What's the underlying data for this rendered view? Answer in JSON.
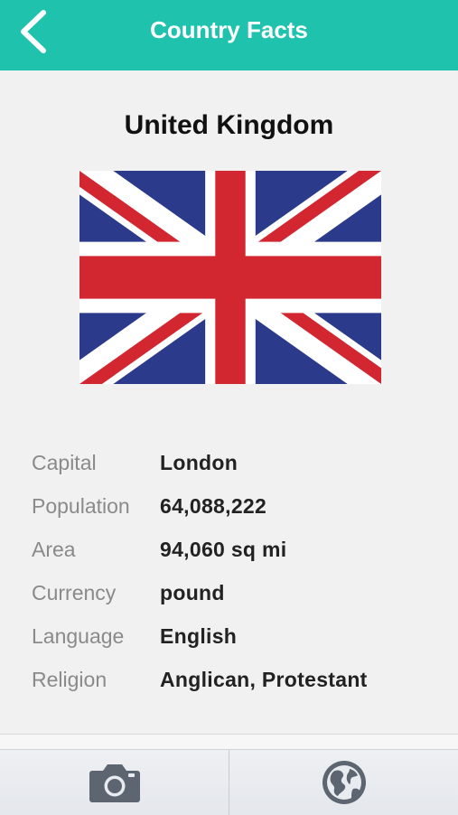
{
  "header": {
    "title": "Country Facts",
    "background": "#1ec2ad",
    "back_icon": "chevron-left-icon"
  },
  "country": {
    "name": "United Kingdom",
    "flag_icon": "union-jack-flag"
  },
  "facts": [
    {
      "label": "Capital",
      "value": "London"
    },
    {
      "label": "Population",
      "value": "64,088,222"
    },
    {
      "label": "Area",
      "value": "94,060 sq mi"
    },
    {
      "label": "Currency",
      "value": "pound"
    },
    {
      "label": "Language",
      "value": "English"
    },
    {
      "label": "Religion",
      "value": "Anglican, Protestant"
    }
  ],
  "tabbar": {
    "tabs": [
      {
        "icon": "camera-icon"
      },
      {
        "icon": "globe-icon"
      }
    ]
  },
  "colors": {
    "accent": "#1ec2ad",
    "flag_blue": "#2b3a8a",
    "flag_red": "#d22630",
    "icon_gray": "#5c6570"
  }
}
